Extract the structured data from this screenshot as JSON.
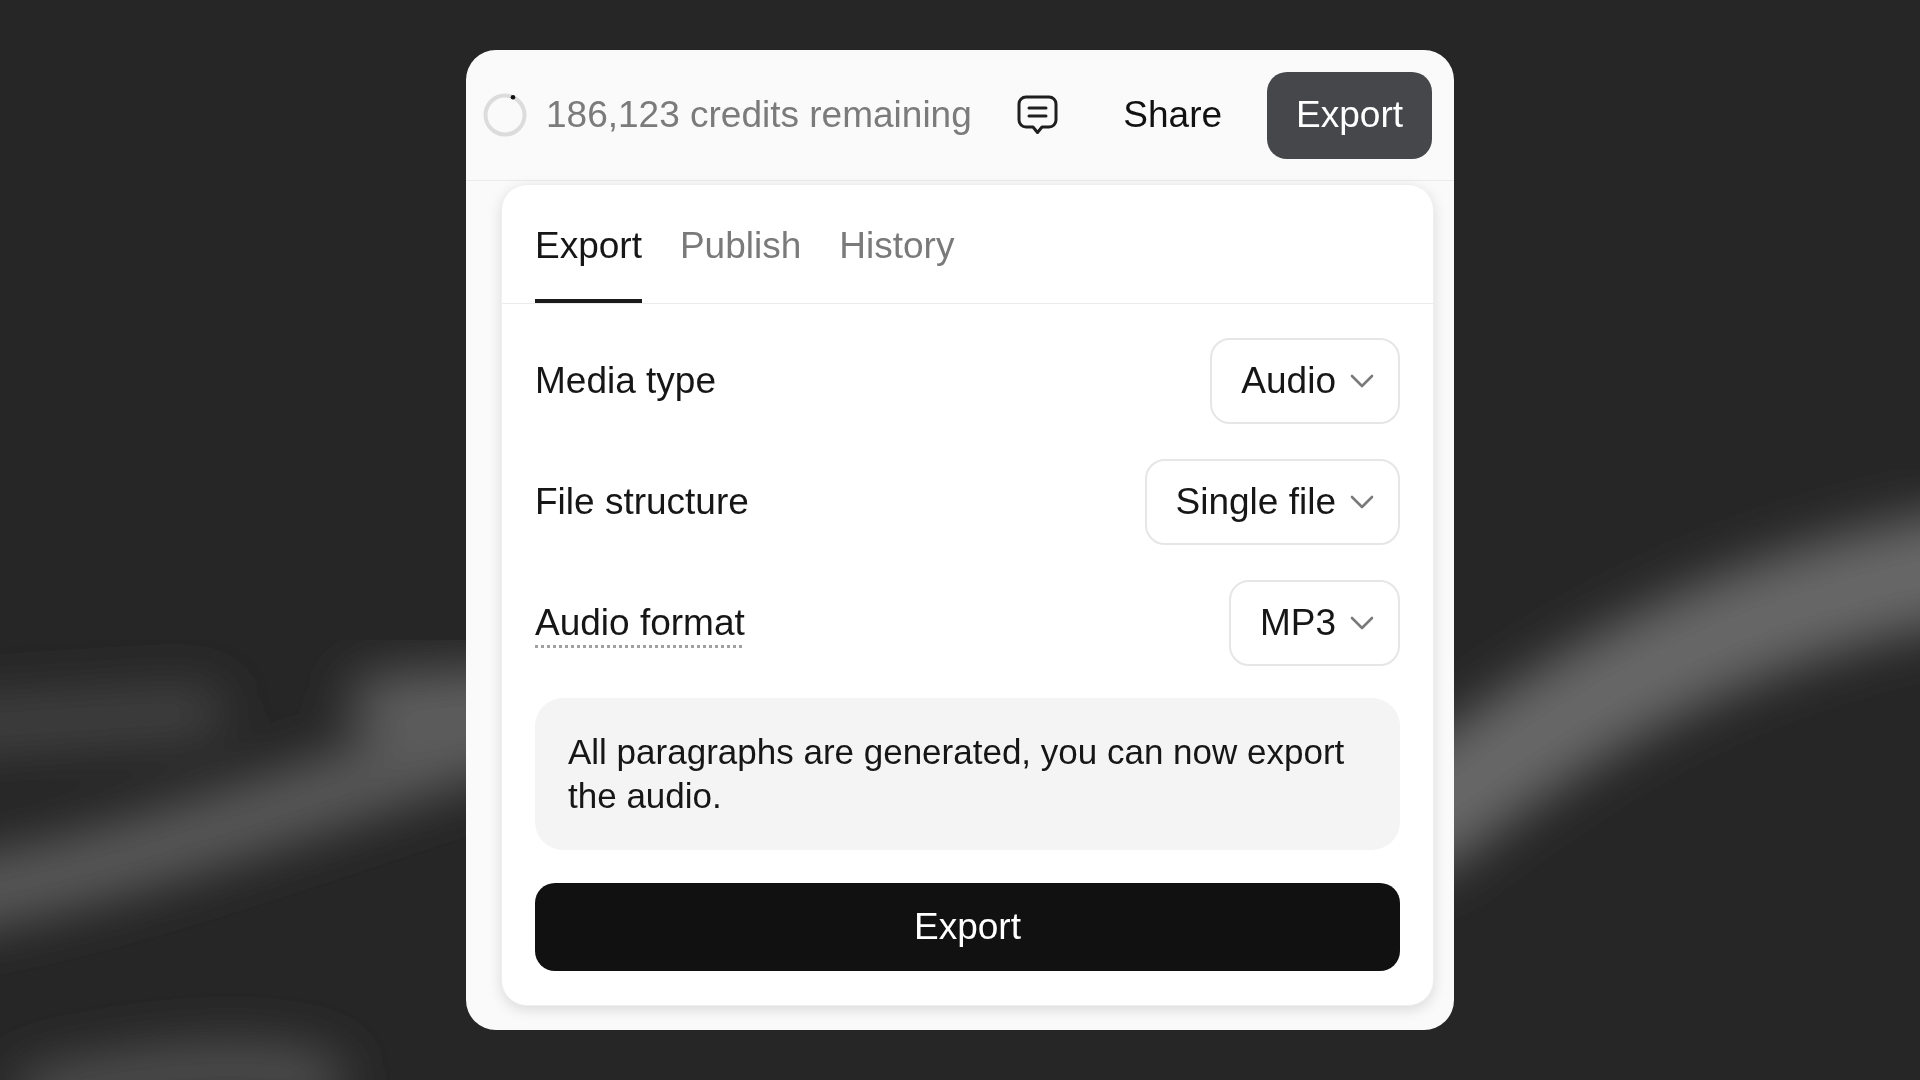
{
  "header": {
    "credits_text": "186,123 credits remaining",
    "share_button": "Share",
    "export_button": "Export"
  },
  "export_panel": {
    "tabs": [
      {
        "label": "Export",
        "selected": true
      },
      {
        "label": "Publish",
        "selected": false
      },
      {
        "label": "History",
        "selected": false
      }
    ],
    "settings": [
      {
        "label": "Media type",
        "value": "Audio",
        "has_tooltip": false
      },
      {
        "label": "File structure",
        "value": "Single file",
        "has_tooltip": false
      },
      {
        "label": "Audio format",
        "value": "MP3",
        "has_tooltip": true
      }
    ],
    "notice": "All paragraphs are generated, you can now export the audio.",
    "export_button": "Export"
  }
}
